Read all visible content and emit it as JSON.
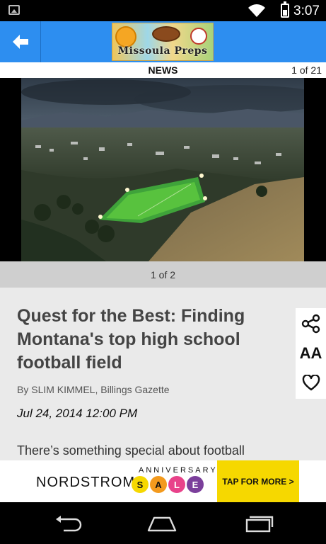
{
  "status_bar": {
    "time": "3:07",
    "icons": [
      "image-notification-icon",
      "wifi-icon",
      "battery-icon"
    ]
  },
  "app_bar": {
    "back_icon": "back-arrow-icon",
    "logo_text": "Missoula Preps"
  },
  "section": {
    "title": "NEWS",
    "counter": "1 of 21"
  },
  "photo": {
    "description_icon": "stadium-photo",
    "caption_counter": "1 of 2"
  },
  "article": {
    "headline": "Quest for the Best: Finding Montana's top high school football field",
    "byline": "By SLIM KIMMEL, Billings Gazette",
    "date": "Jul 24, 2014 12:00 PM",
    "body": "There’s something special about football"
  },
  "side_tools": {
    "share_icon": "share-icon",
    "text_size_label": "AA",
    "favorite_icon": "heart-icon"
  },
  "ad": {
    "brand": "NORDSTROM",
    "anniversary": "ANNIVERSARY",
    "sale_letters": [
      "S",
      "A",
      "L",
      "E"
    ],
    "cta": "TAP FOR MORE >",
    "colors": [
      "#f6d800",
      "#f39a1d",
      "#e8428a",
      "#7b3f9b"
    ]
  },
  "nav_bar": {
    "icons": [
      "back-nav-icon",
      "home-nav-icon",
      "recents-nav-icon"
    ]
  }
}
